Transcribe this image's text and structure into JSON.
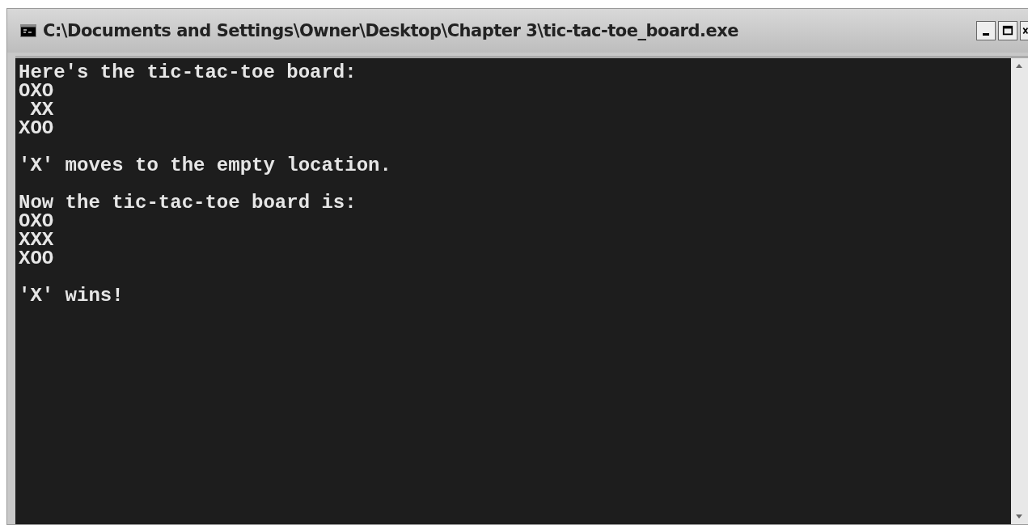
{
  "window": {
    "title": "C:\\Documents and Settings\\Owner\\Desktop\\Chapter 3\\tic-tac-toe_board.exe"
  },
  "console": {
    "blocks": [
      [
        "Here's the tic-tac-toe board:",
        "OXO",
        " XX",
        "XOO"
      ],
      [
        "'X' moves to the empty location."
      ],
      [
        "Now the tic-tac-toe board is:",
        "OXO",
        "XXX",
        "XOO"
      ],
      [
        "'X' wins!"
      ]
    ]
  }
}
